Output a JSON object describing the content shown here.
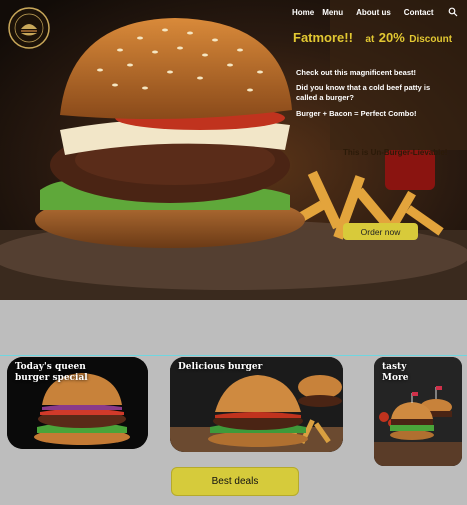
{
  "nav": {
    "home": "Home",
    "menu": "Menu",
    "about": "About us",
    "contact": "Contact",
    "search_icon": "search-icon"
  },
  "promo": {
    "brand": "Fatmore!!",
    "at": "at",
    "percent": "20%",
    "discount": "Discount"
  },
  "hero": {
    "line1": "Check out this magnificent beast!",
    "line2": "Did you know that a cold beef patty is called a burger?",
    "line3": "Burger + Bacon = Perfect Combo!",
    "tagline": "This is Un-Burger-Lievable!",
    "order_label": "Order now"
  },
  "cards": [
    {
      "title_line1": "Today's queen",
      "title_line2": "burger special"
    },
    {
      "title_line1": "Delicious burger",
      "title_line2": ""
    },
    {
      "title_line1": "tasty",
      "title_line2": "More"
    }
  ],
  "footer": {
    "deals_label": "Best deals"
  },
  "colors": {
    "accent_yellow": "#d8ca3a",
    "promo_text": "#e2c832",
    "divider": "#6fd6e0",
    "page_bg": "#bdbdbd"
  }
}
